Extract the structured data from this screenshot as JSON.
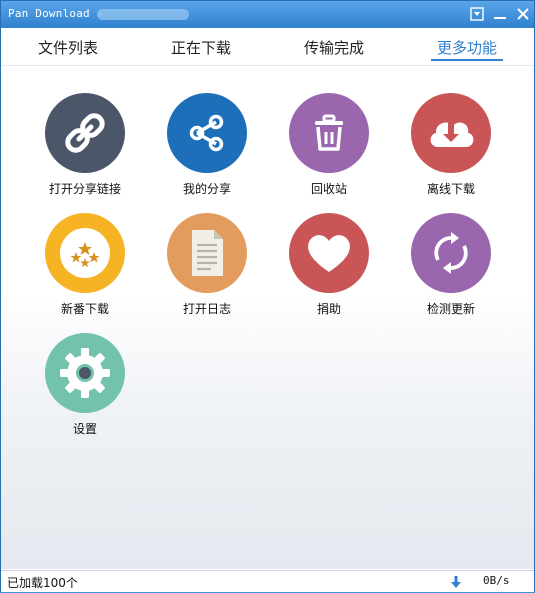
{
  "window": {
    "title": "Pan Download -"
  },
  "tabs": [
    {
      "label": "文件列表"
    },
    {
      "label": "正在下载"
    },
    {
      "label": "传输完成"
    },
    {
      "label": "更多功能",
      "active": true
    }
  ],
  "features": [
    {
      "label": "打开分享链接",
      "icon": "link-icon",
      "color": "#4b5768"
    },
    {
      "label": "我的分享",
      "icon": "share-icon",
      "color": "#1c6fb8"
    },
    {
      "label": "回收站",
      "icon": "trash-icon",
      "color": "#9a66ad"
    },
    {
      "label": "离线下载",
      "icon": "cloud-download-icon",
      "color": "#c95556"
    },
    {
      "label": "新番下载",
      "icon": "stars-badge-icon",
      "color": "#f6b324"
    },
    {
      "label": "打开日志",
      "icon": "document-icon",
      "color": "#e39b5e"
    },
    {
      "label": "捐助",
      "icon": "heart-icon",
      "color": "#c95556"
    },
    {
      "label": "检测更新",
      "icon": "refresh-icon",
      "color": "#9a66ad"
    },
    {
      "label": "设置",
      "icon": "gear-icon",
      "color": "#73c2ad"
    }
  ],
  "status": {
    "loaded_text": "已加载100个",
    "speed": "0B/s",
    "arrow_icon": "download-arrow-icon",
    "arrow_color": "#2f7fd0"
  }
}
